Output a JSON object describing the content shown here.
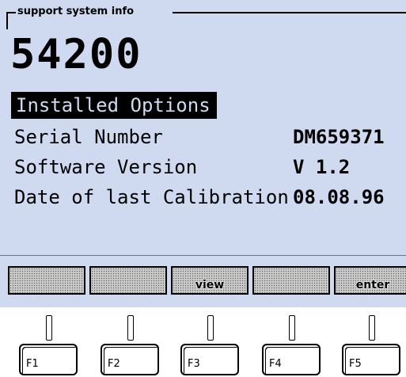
{
  "frame_title": "support system info",
  "model": "54200",
  "selected_item": "Installed Options",
  "rows": [
    {
      "label": "Serial Number",
      "value": "DM659371"
    },
    {
      "label": "Software Version",
      "value": "V 1.2"
    },
    {
      "label": "Date of last Calibration",
      "value": "08.08.96"
    }
  ],
  "softkeys": [
    "",
    "",
    "view",
    "",
    "enter"
  ],
  "function_keys": [
    "F1",
    "F2",
    "F3",
    "F4",
    "F5"
  ],
  "colors": {
    "screen_bg": "#cfd9f0",
    "highlight_bg": "#000000"
  }
}
